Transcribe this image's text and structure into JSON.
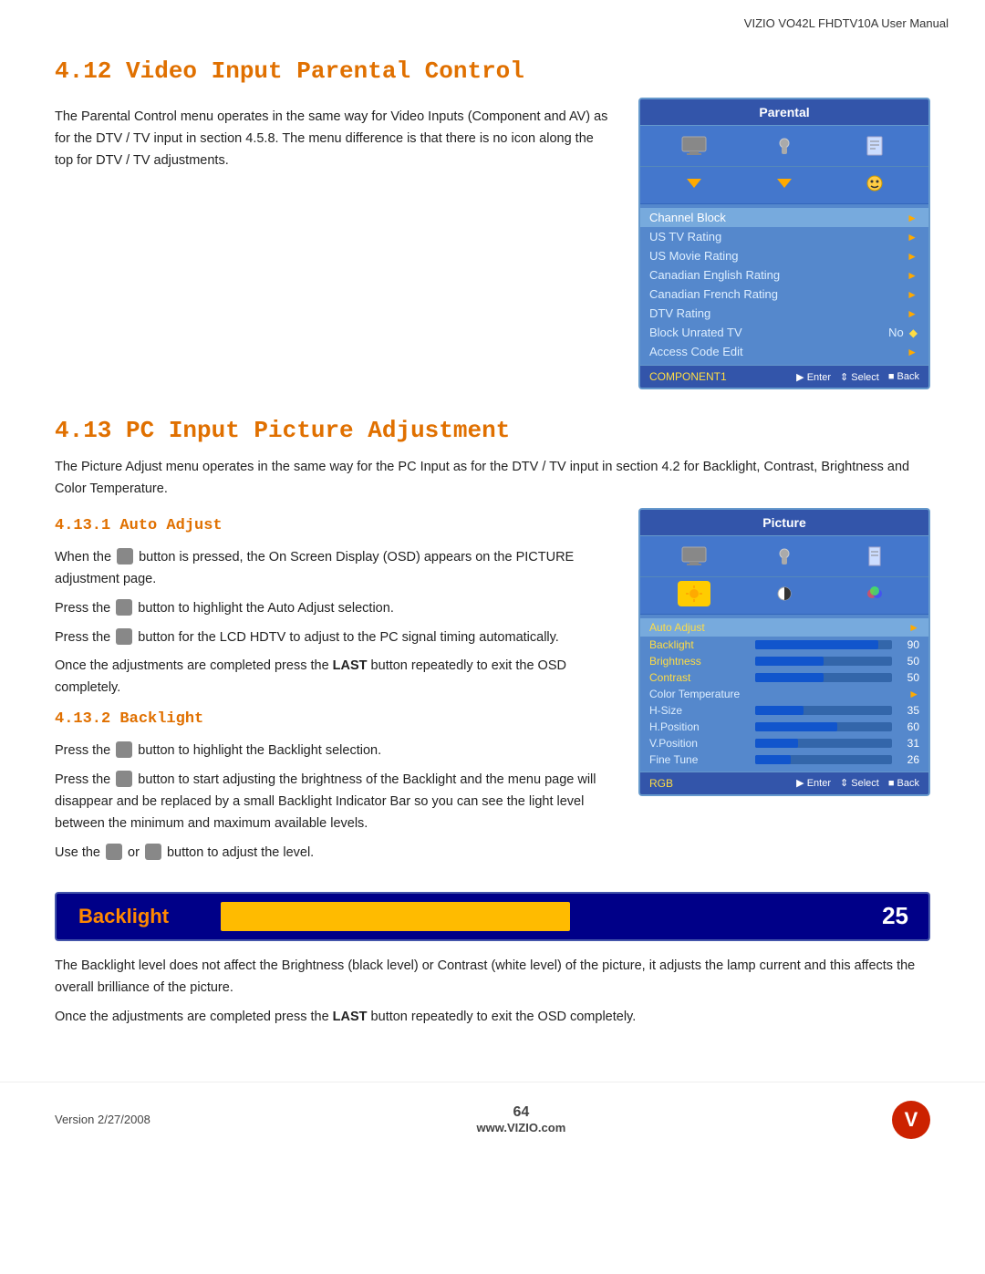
{
  "header": {
    "title": "VIZIO VO42L FHDTV10A User Manual"
  },
  "section412": {
    "title": "4.12 Video Input Parental Control",
    "body_text": "The Parental Control menu operates in the same way for Video Inputs (Component and AV) as for the DTV / TV input in section 4.5.8.  The menu difference is that there is no icon along the top for DTV / TV adjustments.",
    "menu": {
      "title": "Parental",
      "items": [
        {
          "label": "Channel Block",
          "value": "",
          "arrow": true,
          "highlighted": true
        },
        {
          "label": "US TV Rating",
          "value": "",
          "arrow": true
        },
        {
          "label": "US Movie Rating",
          "value": "",
          "arrow": true
        },
        {
          "label": "Canadian English Rating",
          "value": "",
          "arrow": true
        },
        {
          "label": "Canadian French Rating",
          "value": "",
          "arrow": true
        },
        {
          "label": "DTV Rating",
          "value": "",
          "arrow": true
        },
        {
          "label": "Block Unrated TV",
          "value": "No",
          "arrow": false,
          "diamond": true
        },
        {
          "label": "Access Code Edit",
          "value": "",
          "arrow": true
        }
      ],
      "footer_left": "COMPONENT1",
      "footer_right": "Enter  Select  Back"
    }
  },
  "section413": {
    "title": "4.13 PC Input Picture Adjustment",
    "intro": "The Picture Adjust menu operates in the same way for the PC Input as for the DTV / TV input in section 4.2 for Backlight, Contrast, Brightness and Color Temperature.",
    "subsections": {
      "autoadjust": {
        "title": "4.13.1 Auto Adjust",
        "paragraphs": [
          "When the  button is pressed, the On Screen Display (OSD) appears on the PICTURE adjustment page.",
          "Press the  button to highlight the Auto Adjust selection.",
          "Press the  button for the LCD HDTV to adjust to the PC signal timing automatically.",
          "Once the adjustments are completed press the LAST button repeatedly to exit the OSD completely."
        ]
      },
      "backlight": {
        "title": "4.13.2 Backlight",
        "paragraphs": [
          "Press the  button to highlight the Backlight selection.",
          "Press the  button to start adjusting the brightness of the Backlight and the menu page will disappear and be replaced by a small Backlight Indicator Bar so you can see the light level between the minimum and maximum available levels.",
          "Use the  or  button to adjust the level."
        ],
        "bar": {
          "label": "Backlight",
          "value": "25",
          "fill_pct": 50
        },
        "post_paragraphs": [
          "The Backlight level does not affect the Brightness (black level) or Contrast (white level) of the picture, it adjusts the lamp current and this affects the overall brilliance of the picture.",
          "Once the adjustments are completed press the LAST button repeatedly to exit the OSD completely."
        ]
      }
    },
    "menu": {
      "title": "Picture",
      "rows": [
        {
          "type": "arrow",
          "label": "Auto Adjust",
          "value": "",
          "arrow": true,
          "highlighted": true
        },
        {
          "type": "bar",
          "label": "Backlight",
          "value": "90",
          "fill_pct": 90
        },
        {
          "type": "bar",
          "label": "Brightness",
          "value": "50",
          "fill_pct": 50
        },
        {
          "type": "bar",
          "label": "Contrast",
          "value": "50",
          "fill_pct": 50
        },
        {
          "type": "arrow",
          "label": "Color Temperature",
          "value": "",
          "arrow": true
        },
        {
          "type": "bar",
          "label": "H-Size",
          "value": "35",
          "fill_pct": 35
        },
        {
          "type": "bar",
          "label": "H.Position",
          "value": "60",
          "fill_pct": 60
        },
        {
          "type": "bar",
          "label": "V.Position",
          "value": "31",
          "fill_pct": 31
        },
        {
          "type": "bar",
          "label": "Fine Tune",
          "value": "26",
          "fill_pct": 26
        }
      ],
      "footer_left": "RGB",
      "footer_right": "Enter  Select  Back"
    }
  },
  "footer": {
    "version": "Version 2/27/2008",
    "page": "64",
    "website": "www.VIZIO.com",
    "logo_text": "V"
  }
}
